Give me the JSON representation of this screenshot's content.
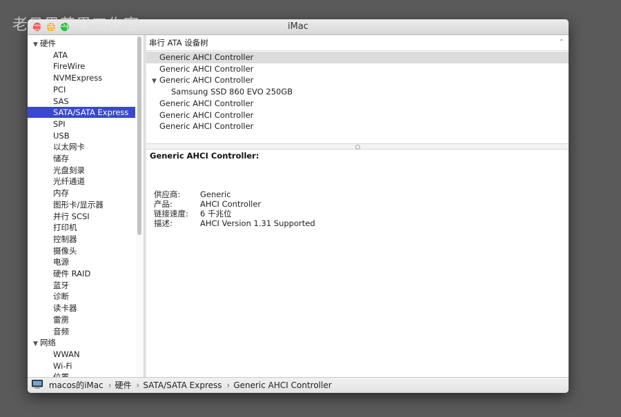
{
  "watermark": "老吕黑苹果工作室",
  "window": {
    "title": "iMac"
  },
  "sidebar": {
    "groups": [
      {
        "label": "硬件",
        "expanded": true,
        "items": [
          "ATA",
          "FireWire",
          "NVMExpress",
          "PCI",
          "SAS",
          "SATA/SATA Express",
          "SPI",
          "USB",
          "以太网卡",
          "储存",
          "光盘刻录",
          "光纤通道",
          "内存",
          "图形卡/显示器",
          "并行 SCSI",
          "打印机",
          "控制器",
          "摄像头",
          "电源",
          "硬件 RAID",
          "蓝牙",
          "诊断",
          "读卡器",
          "雷雳",
          "音频"
        ]
      },
      {
        "label": "网络",
        "expanded": true,
        "items": [
          "WWAN",
          "Wi-Fi",
          "位置"
        ]
      }
    ],
    "selected": "SATA/SATA Express"
  },
  "content": {
    "header": "串行 ATA 设备树",
    "tree": [
      {
        "label": "Generic AHCI Controller",
        "level": 0,
        "selected": true,
        "expanded": false
      },
      {
        "label": "Generic AHCI Controller",
        "level": 0,
        "selected": false,
        "expanded": false
      },
      {
        "label": "Generic AHCI Controller",
        "level": 0,
        "selected": false,
        "expanded": true
      },
      {
        "label": "Samsung SSD 860 EVO 250GB",
        "level": 1,
        "selected": false,
        "expanded": false
      },
      {
        "label": "Generic AHCI Controller",
        "level": 0,
        "selected": false,
        "expanded": false
      },
      {
        "label": "Generic AHCI Controller",
        "level": 0,
        "selected": false,
        "expanded": false
      },
      {
        "label": "Generic AHCI Controller",
        "level": 0,
        "selected": false,
        "expanded": false
      }
    ]
  },
  "detail": {
    "title": "Generic AHCI Controller:",
    "properties": [
      {
        "key": "供应商:",
        "value": "Generic"
      },
      {
        "key": "产品:",
        "value": "AHCI Controller"
      },
      {
        "key": "链接速度:",
        "value": "6 千兆位"
      },
      {
        "key": "描述:",
        "value": "AHCI Version 1.31 Supported"
      }
    ]
  },
  "statusbar": {
    "icon": "imac-icon",
    "crumbs": [
      "macos的iMac",
      "硬件",
      "SATA/SATA Express",
      "Generic AHCI Controller"
    ],
    "separator": "›"
  },
  "colors": {
    "selection": "#3a48d0",
    "close": "#ff5f57",
    "minimize": "#ffbd2e",
    "maximize": "#28c940"
  }
}
